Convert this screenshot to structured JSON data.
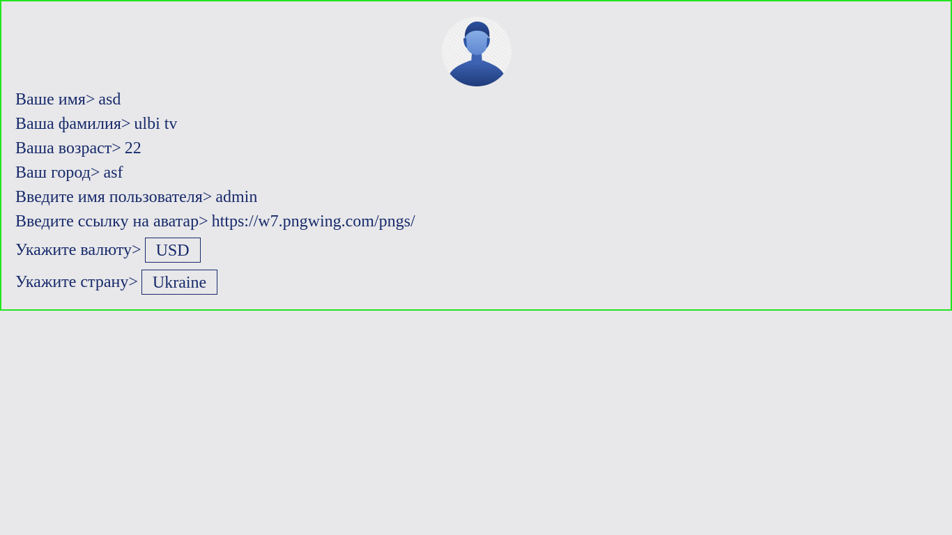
{
  "profile": {
    "avatar": {
      "icon": "person-silhouette-icon"
    },
    "fields": [
      {
        "label": "Ваше имя>",
        "value": "asd"
      },
      {
        "label": "Ваша фамилия>",
        "value": "ulbi tv"
      },
      {
        "label": "Ваша возраст>",
        "value": "22"
      },
      {
        "label": "Ваш город>",
        "value": "asf"
      },
      {
        "label": "Введите имя пользователя>",
        "value": "admin"
      },
      {
        "label": "Введите ссылку на аватар>",
        "value": "https://w7.pngwing.com/pngs/"
      }
    ],
    "currency": {
      "label": "Укажите валюту>",
      "value": "USD"
    },
    "country": {
      "label": "Укажите страну>",
      "value": "Ukraine"
    }
  },
  "colors": {
    "text": "#172a6b",
    "border": "#22e51f",
    "background": "#e8e8ea"
  }
}
